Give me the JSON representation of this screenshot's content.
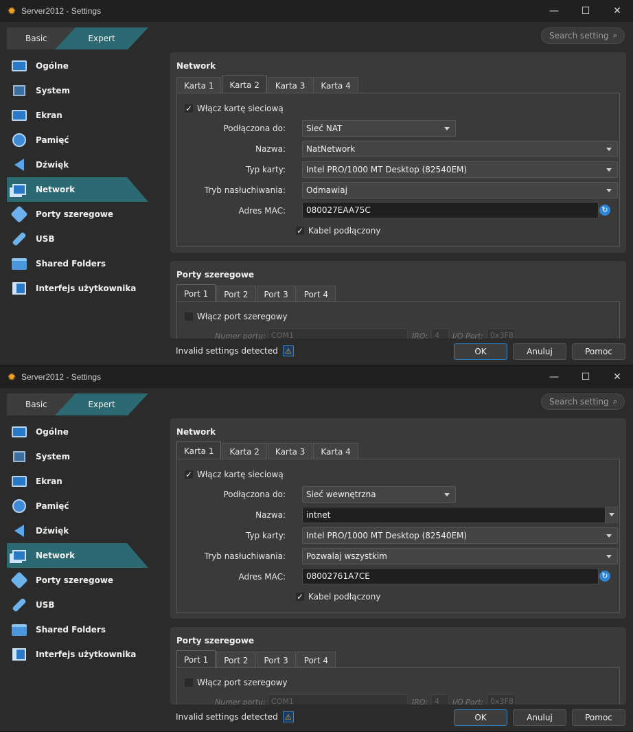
{
  "windows": [
    {
      "title": "Server2012 - Settings",
      "mode_tabs": {
        "basic": "Basic",
        "expert": "Expert"
      },
      "search": {
        "placeholder": "Search settings"
      },
      "sidebar": [
        {
          "label": "Ogólne",
          "icon": "monitor-icon"
        },
        {
          "label": "System",
          "icon": "chip-icon"
        },
        {
          "label": "Ekran",
          "icon": "display-icon"
        },
        {
          "label": "Pamięć",
          "icon": "disc-icon"
        },
        {
          "label": "Dźwięk",
          "icon": "speaker-icon"
        },
        {
          "label": "Network",
          "icon": "network-icon",
          "active": true
        },
        {
          "label": "Porty szeregowe",
          "icon": "serial-port-icon"
        },
        {
          "label": "USB",
          "icon": "usb-icon"
        },
        {
          "label": "Shared Folders",
          "icon": "folder-icon"
        },
        {
          "label": "Interfejs użytkownika",
          "icon": "user-interface-icon"
        }
      ],
      "network": {
        "title": "Network",
        "tabs": [
          "Karta 1",
          "Karta 2",
          "Karta 3",
          "Karta 4"
        ],
        "active_tab": "Karta 2",
        "enable_label": "Włącz kartę sieciową",
        "attached_label": "Podłączona do:",
        "attached_value": "Sieć NAT",
        "name_label": "Nazwa:",
        "name_value": "NatNetwork",
        "type_label": "Typ karty:",
        "type_value": "Intel PRO/1000 MT Desktop (82540EM)",
        "promisc_label": "Tryb nasłuchiwania:",
        "promisc_value": "Odmawiaj",
        "mac_label": "Adres MAC:",
        "mac_value": "080027EAA75C",
        "cable_label": "Kabel podłączony"
      },
      "serial": {
        "title": "Porty szeregowe",
        "tabs": [
          "Port 1",
          "Port 2",
          "Port 3",
          "Port 4"
        ],
        "enable_label": "Włącz port szeregowy",
        "port_number_label": "Numer portu:",
        "port_number_value": "COM1",
        "irq_label": "IRQ:",
        "irq_value": "4",
        "io_port_label": "I/O Port:",
        "io_port_value": "0x3F8"
      },
      "status": "Invalid settings detected",
      "buttons": {
        "ok": "OK",
        "cancel": "Anuluj",
        "help": "Pomoc"
      }
    },
    {
      "title": "Server2012 - Settings",
      "mode_tabs": {
        "basic": "Basic",
        "expert": "Expert"
      },
      "search": {
        "placeholder": "Search settings"
      },
      "sidebar": [
        {
          "label": "Ogólne",
          "icon": "monitor-icon"
        },
        {
          "label": "System",
          "icon": "chip-icon"
        },
        {
          "label": "Ekran",
          "icon": "display-icon"
        },
        {
          "label": "Pamięć",
          "icon": "disc-icon"
        },
        {
          "label": "Dźwięk",
          "icon": "speaker-icon"
        },
        {
          "label": "Network",
          "icon": "network-icon",
          "active": true
        },
        {
          "label": "Porty szeregowe",
          "icon": "serial-port-icon"
        },
        {
          "label": "USB",
          "icon": "usb-icon"
        },
        {
          "label": "Shared Folders",
          "icon": "folder-icon"
        },
        {
          "label": "Interfejs użytkownika",
          "icon": "user-interface-icon"
        }
      ],
      "network": {
        "title": "Network",
        "tabs": [
          "Karta 1",
          "Karta 2",
          "Karta 3",
          "Karta 4"
        ],
        "active_tab": "Karta 1",
        "enable_label": "Włącz kartę sieciową",
        "attached_label": "Podłączona do:",
        "attached_value": "Sieć wewnętrzna",
        "name_label": "Nazwa:",
        "name_value": "intnet",
        "type_label": "Typ karty:",
        "type_value": "Intel PRO/1000 MT Desktop (82540EM)",
        "promisc_label": "Tryb nasłuchiwania:",
        "promisc_value": "Pozwalaj wszystkim",
        "mac_label": "Adres MAC:",
        "mac_value": "08002761A7CE",
        "cable_label": "Kabel podłączony"
      },
      "serial": {
        "title": "Porty szeregowe",
        "tabs": [
          "Port 1",
          "Port 2",
          "Port 3",
          "Port 4"
        ],
        "enable_label": "Włącz port szeregowy",
        "port_number_label": "Numer portu:",
        "port_number_value": "COM1",
        "irq_label": "IRQ:",
        "irq_value": "4",
        "io_port_label": "I/O Port:",
        "io_port_value": "0x3F8"
      },
      "status": "Invalid settings detected",
      "buttons": {
        "ok": "OK",
        "cancel": "Anuluj",
        "help": "Pomoc"
      }
    }
  ]
}
